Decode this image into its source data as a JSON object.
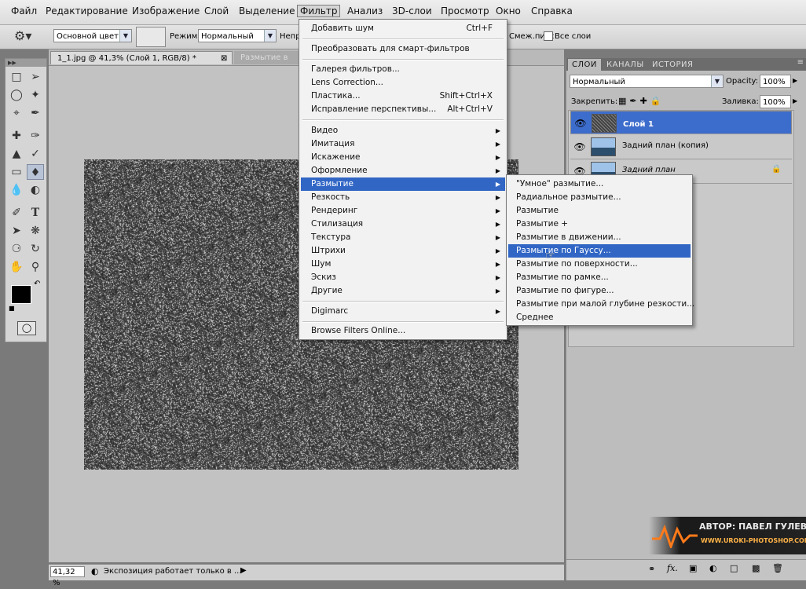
{
  "menubar": [
    "Файл",
    "Редактирование",
    "Изображение",
    "Слой",
    "Выделение",
    "Фильтр",
    "Анализ",
    "3D-слои",
    "Просмотр",
    "Окно",
    "Справка"
  ],
  "options": {
    "source_value": "Основной цвет",
    "mode_label": "Режим:",
    "mode_value": "Нормальный",
    "opacity_label": "Непр",
    "smooth_label": "Смеж.пикс",
    "all_layers_label": "Все слои"
  },
  "tabs": [
    "1_1.jpg @ 41,3% (Слой 1, RGB/8) *",
    "Размытие в"
  ],
  "status": {
    "zoom": "41,32 %",
    "message": "Экспозиция работает только в ..."
  },
  "panel": {
    "tabs": [
      "СЛОИ",
      "КАНАЛЫ",
      "ИСТОРИЯ"
    ],
    "blend_mode": "Нормальный",
    "opacity_label": "Opacity:",
    "opacity_value": "100%",
    "lock_label": "Закрепить:",
    "fill_label": "Заливка:",
    "fill_value": "100%",
    "layers": [
      "Слой 1",
      "Задний план (копия)",
      "Задний план"
    ],
    "footer_icons": [
      "fx-icon",
      "mask-icon",
      "adjustment-icon",
      "group-icon",
      "new-layer-icon",
      "trash-icon"
    ]
  },
  "filter_menu": {
    "items": [
      {
        "label": "Добавить шум",
        "shortcut": "Ctrl+F"
      },
      {
        "label": "Преобразовать для смарт-фильтров"
      },
      {
        "label": "Галерея фильтров..."
      },
      {
        "label": "Lens Correction..."
      },
      {
        "label": "Пластика...",
        "shortcut": "Shift+Ctrl+X"
      },
      {
        "label": "Исправление перспективы...",
        "shortcut": "Alt+Ctrl+V"
      },
      {
        "label": "Видео",
        "submenu": true
      },
      {
        "label": "Имитация",
        "submenu": true
      },
      {
        "label": "Искажение",
        "submenu": true
      },
      {
        "label": "Оформление",
        "submenu": true
      },
      {
        "label": "Размытие",
        "submenu": true,
        "highlighted": true
      },
      {
        "label": "Резкость",
        "submenu": true
      },
      {
        "label": "Рендеринг",
        "submenu": true
      },
      {
        "label": "Стилизация",
        "submenu": true
      },
      {
        "label": "Текстура",
        "submenu": true
      },
      {
        "label": "Штрихи",
        "submenu": true
      },
      {
        "label": "Шум",
        "submenu": true
      },
      {
        "label": "Эскиз",
        "submenu": true
      },
      {
        "label": "Другие",
        "submenu": true
      },
      {
        "label": "Digimarc",
        "submenu": true
      },
      {
        "label": "Browse Filters Online..."
      }
    ]
  },
  "blur_menu": {
    "items": [
      "\"Умное\" размытие...",
      "Радиальное размытие...",
      "Размытие",
      "Размытие +",
      "Размытие в движении...",
      "Размытие по Гауссу...",
      "Размытие по поверхности...",
      "Размытие по рамке...",
      "Размытие по фигуре...",
      "Размытие при малой глубине резкости...",
      "Среднее"
    ],
    "highlighted_index": 5
  },
  "watermark": {
    "author": "АВТОР: ПАВЕЛ ГУЛЕВИЧ",
    "site": "WWW.UROKI-PHOTOSHOP.COM"
  },
  "colors": {
    "highlight": "#3166c5",
    "layer_selected": "#3d6dcc"
  }
}
